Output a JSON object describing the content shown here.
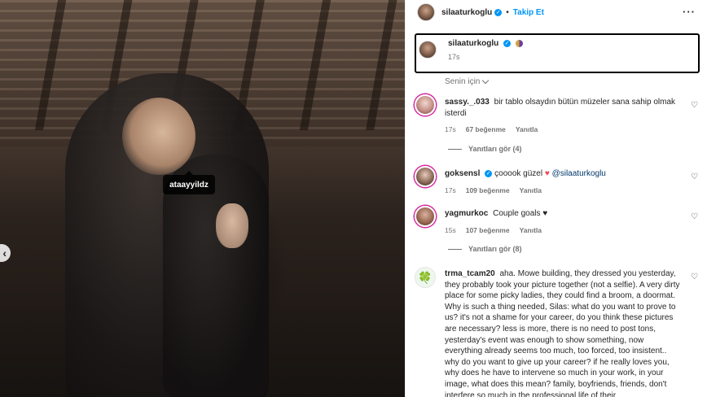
{
  "photo": {
    "tag_label": "ataayyildz",
    "prev_icon": "chevron-left-icon"
  },
  "header": {
    "username": "silaaturkoglu",
    "separator": "•",
    "follow_label": "Takip Et",
    "more_icon": "more-horizontal-icon",
    "more_glyph": "···"
  },
  "caption": {
    "username": "silaaturkoglu",
    "time": "17s"
  },
  "sort": {
    "label": "Senin için"
  },
  "comments": [
    {
      "username": "sassy._.033",
      "text": "bir tablo olsaydın bütün müzeler sana sahip olmak isterdi",
      "time": "17s",
      "likes": "67 beğenme",
      "reply": "Yanıtla",
      "view_replies": "Yanıtları gör (4)"
    },
    {
      "username": "goksensl",
      "text_before": "çooook güzel",
      "mention": "@silaaturkoglu",
      "time": "17s",
      "likes": "109 beğenme",
      "reply": "Yanıtla"
    },
    {
      "username": "yagmurkoc",
      "text": "Couple goals",
      "time": "15s",
      "likes": "107 beğenme",
      "reply": "Yanıtla",
      "view_replies": "Yanıtları gör (8)"
    },
    {
      "username": "trma_tcam20",
      "text": "aha. Mowe building, they dressed you yesterday, they probably took your picture together (not a selfie). A very dirty place for some picky ladies, they could find a broom, a doormat. Why is such a thing needed, Silas: what do you want to prove to us? it's not a shame for your career, do you think these pictures are necessary? less is more, there is no need to post tons, yesterday's event was enough to show something, now everything already seems too much, too forced, too insistent.. why do you want to give up your career? if he really loves you, why does he have to intervene so much in your work, in your image, what does this mean? family, boyfriends, friends, don't interfere so much in the professional life of their"
    }
  ],
  "glyphs": {
    "verified": "✓",
    "heart_outline": "♡",
    "heart_red": "♥",
    "heart_black": "♥",
    "clover": "🍀",
    "prev": "‹"
  }
}
